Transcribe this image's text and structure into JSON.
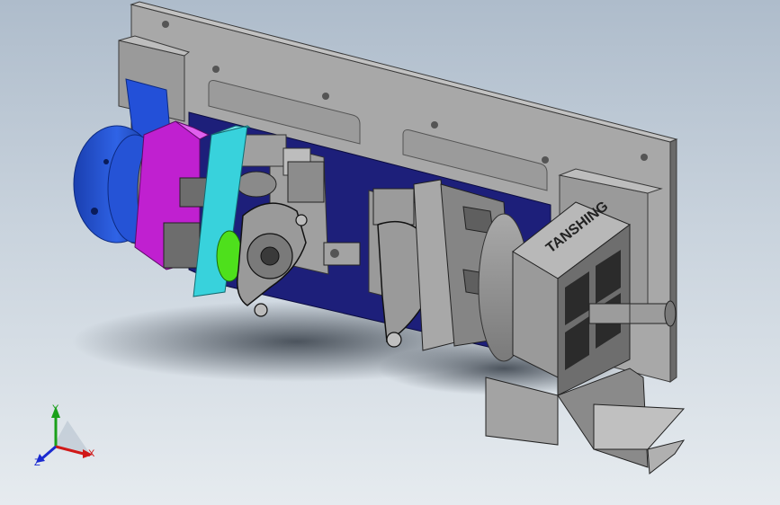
{
  "viewport": {
    "background_top": "#aebccb",
    "background_bottom": "#e6ebef"
  },
  "model": {
    "brand_label": "TANSHING",
    "colors": {
      "plate": "#8e8e8e",
      "plate_light": "#a9a9a9",
      "base_plate": "#1d1f7a",
      "rotary_flange": "#1f4fd0",
      "magenta_flange": "#c020d0",
      "cyan_plate": "#38d2dc",
      "green_ring": "#4ee01c",
      "machinery_gray": "#6d6d6d",
      "dark_part": "#2b2b2b"
    }
  },
  "triad": {
    "x_label": "X",
    "y_label": "Y",
    "z_label": "Z",
    "x_color": "#d01818",
    "y_color": "#1aa01a",
    "z_color": "#1a2ad0"
  }
}
